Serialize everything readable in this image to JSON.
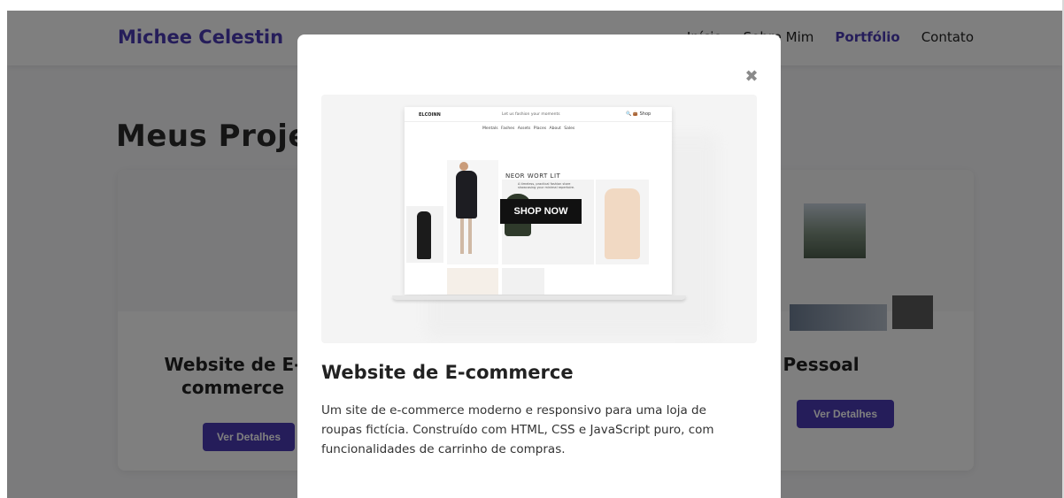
{
  "navbar": {
    "brand": "Michee Celestin",
    "links": [
      "Início",
      "Sobre Mim",
      "Portfólio",
      "Contato"
    ],
    "active_link": "Portfólio"
  },
  "section": {
    "title": "Meus Projetos"
  },
  "cards": [
    {
      "title_line1": "Website de E-",
      "title_line2": "commerce",
      "button": "Ver Detalhes"
    },
    {
      "title": "Blog Pessoal",
      "button": "Ver Detalhes"
    }
  ],
  "modal": {
    "close_glyph": "✖",
    "title": "Website de E-commerce",
    "description": "Um site de e-commerce moderno e responsivo para uma loja de roupas fictícia. Construído com HTML, CSS e JavaScript puro, com funcionalidades de carrinho de compras.",
    "preview": {
      "brand": "ELCOINN",
      "tagline": "Let us fashion your moments",
      "icons": "🔍 👜 Shop",
      "menu": "Mentals Fashes Assets Places About Sales",
      "hero_heading": "NEOR WORT LIT",
      "hero_sub": "A timeless, practical fashion store showcasing your minimal repertoire.",
      "shop_button": "SHOP NOW"
    }
  },
  "colors": {
    "accent": "#4b3bb5",
    "overlay": "rgba(0,0,0,0.5)",
    "button_bg": "#4b3bb5"
  }
}
